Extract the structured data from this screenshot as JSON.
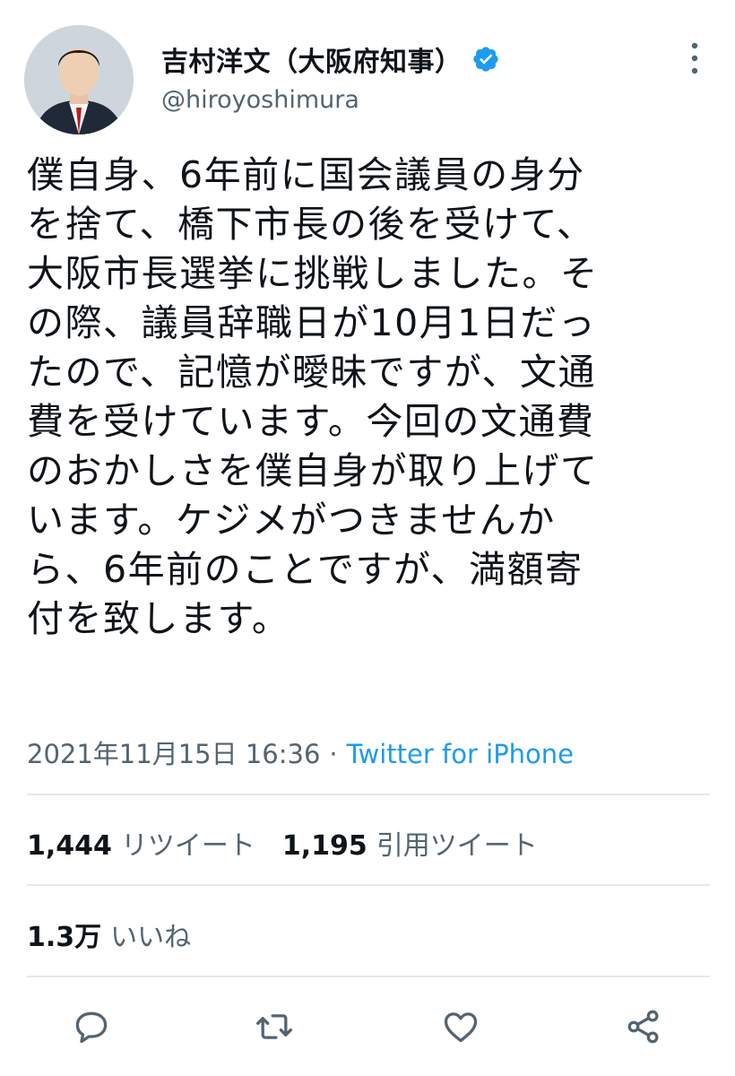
{
  "author": {
    "display_name": "吉村洋文（大阪府知事）",
    "handle": "@hiroyoshimura",
    "verified": true
  },
  "tweet": {
    "text": "僕自身、6年前に国会議員の身分\nを捨て、橋下市長の後を受けて、\n大阪市長選挙に挑戦しました。そ\nの際、議員辞職日が10月1日だっ\nたので、記憶が曖昧ですが、文通\n費を受けています。今回の文通費\nのおかしさを僕自身が取り上げて\nいます。ケジメがつきませんか\nら、6年前のことですが、満額寄\n付を致します。",
    "timestamp": "2021年11月15日 16:36",
    "separator": "·",
    "source": "Twitter for iPhone"
  },
  "stats": {
    "retweets_count": "1,444",
    "retweets_label": "リツイート",
    "quotes_count": "1,195",
    "quotes_label": "引用ツイート",
    "likes_count": "1.3万",
    "likes_label": "いいね"
  },
  "colors": {
    "accent": "#1d9bf0",
    "text_primary": "#0f1419",
    "text_secondary": "#536471",
    "divider": "#e6e9ec"
  },
  "icons": {
    "verified": "verified-badge-icon",
    "more": "more-vertical-icon",
    "reply": "reply-icon",
    "retweet": "retweet-icon",
    "like": "heart-icon",
    "share": "share-icon"
  }
}
